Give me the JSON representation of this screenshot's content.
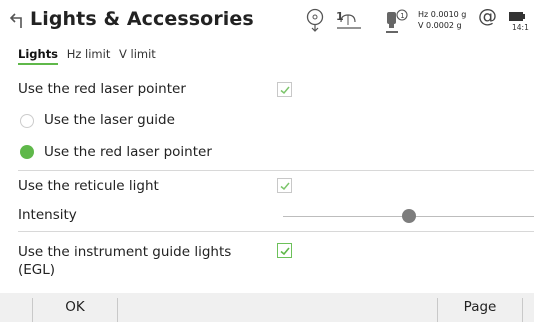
{
  "header": {
    "title": "Lights & Accessories",
    "hz_reading": "Hz 0.0010 g",
    "v_reading": "V  0.0002 g",
    "face_label": "1",
    "at_symbol": "@",
    "time": "14:1"
  },
  "tabs": [
    {
      "label": "Lights",
      "active": true
    },
    {
      "label": "Hz limit",
      "active": false
    },
    {
      "label": "V limit",
      "active": false
    }
  ],
  "settings": {
    "red_laser_label": "Use the red laser pointer",
    "red_laser_checked": true,
    "radio_options": [
      {
        "label": "Use the laser guide",
        "selected": false
      },
      {
        "label": "Use the red laser pointer",
        "selected": true
      }
    ],
    "reticule_label": "Use the reticule light",
    "reticule_checked": true,
    "intensity_label": "Intensity",
    "intensity_level": 0.5,
    "egl_label_line1": "Use the instrument guide lights",
    "egl_label_line2": "(EGL)",
    "egl_checked": true
  },
  "footer": {
    "ok_label": "OK",
    "page_label": "Page"
  },
  "colors": {
    "accent": "#5fb84a",
    "footer_bg": "#f0f0f0",
    "separator": "#d8d8d8"
  }
}
